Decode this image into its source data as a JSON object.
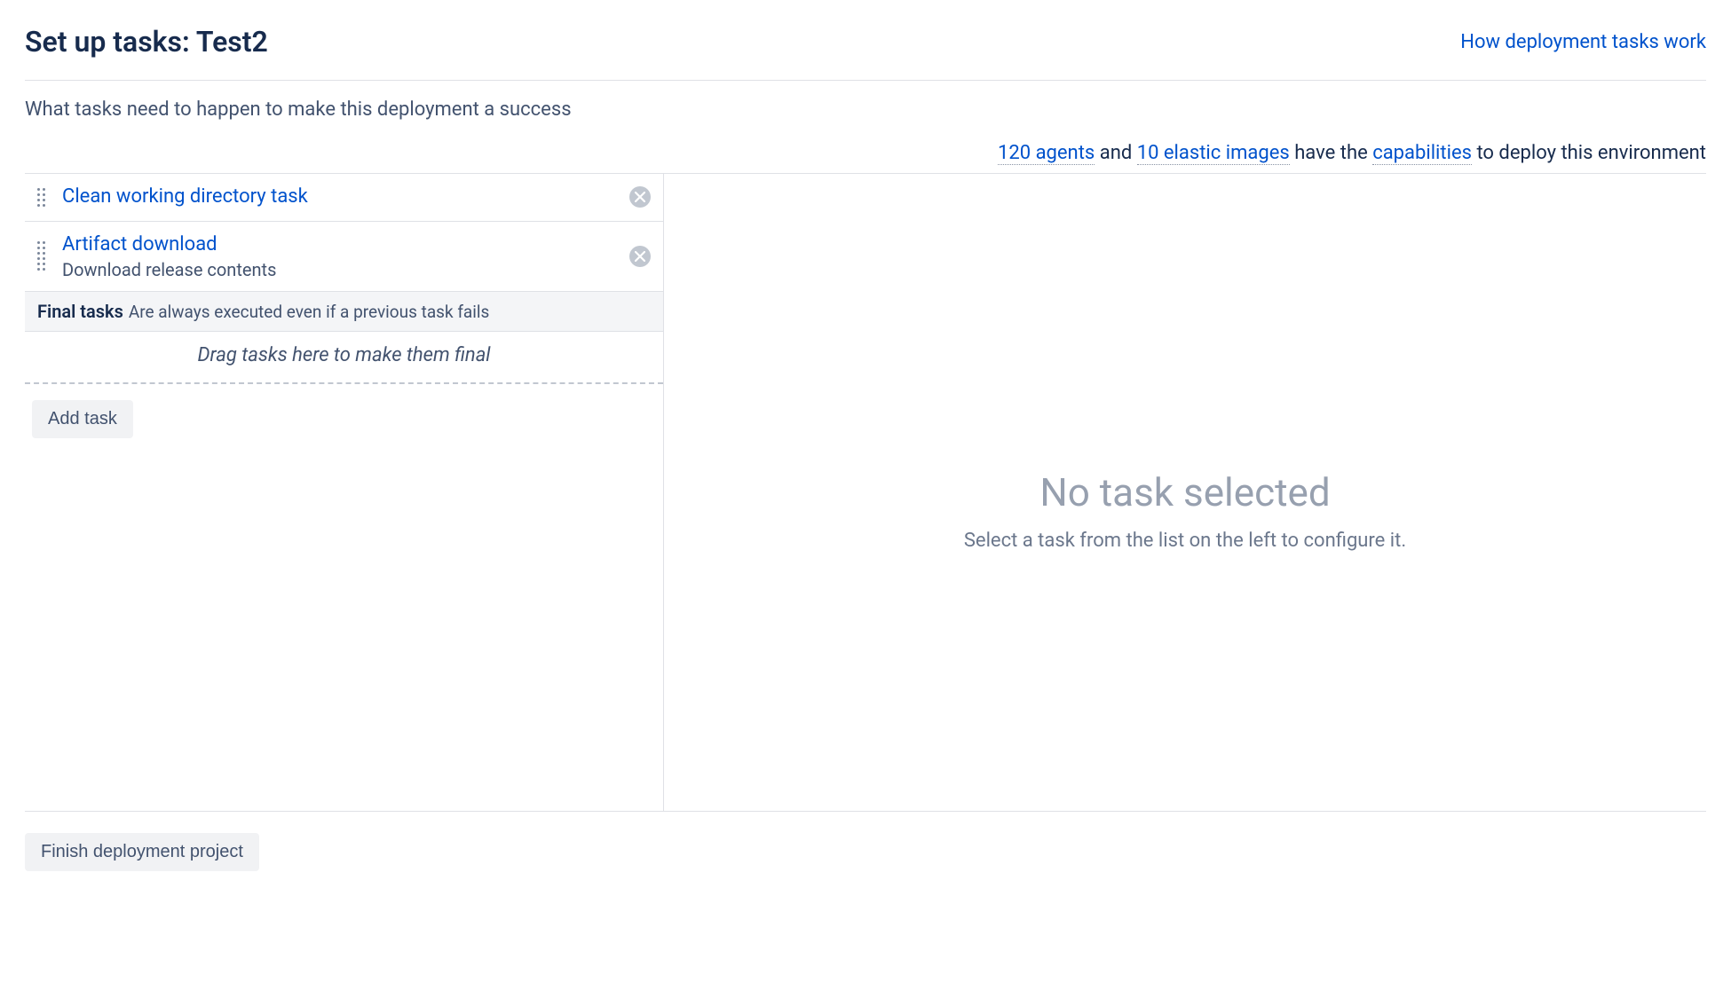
{
  "header": {
    "title": "Set up tasks: Test2",
    "helpLink": "How deployment tasks work"
  },
  "subtitle": "What tasks need to happen to make this deployment a success",
  "agents": {
    "agentsLink": "120 agents",
    "and": " and ",
    "elasticLink": "10 elastic images",
    "have": " have the ",
    "capabilitiesLink": "capabilities",
    "rest": " to deploy this environment"
  },
  "tasks": [
    {
      "title": "Clean working directory task",
      "sub": ""
    },
    {
      "title": "Artifact download",
      "sub": "Download release contents"
    }
  ],
  "final": {
    "label": "Final tasks",
    "desc": "Are always executed even if a previous task fails",
    "dropzone": "Drag tasks here to make them final"
  },
  "buttons": {
    "addTask": "Add task",
    "finish": "Finish deployment project"
  },
  "empty": {
    "title": "No task selected",
    "sub": "Select a task from the list on the left to configure it."
  }
}
